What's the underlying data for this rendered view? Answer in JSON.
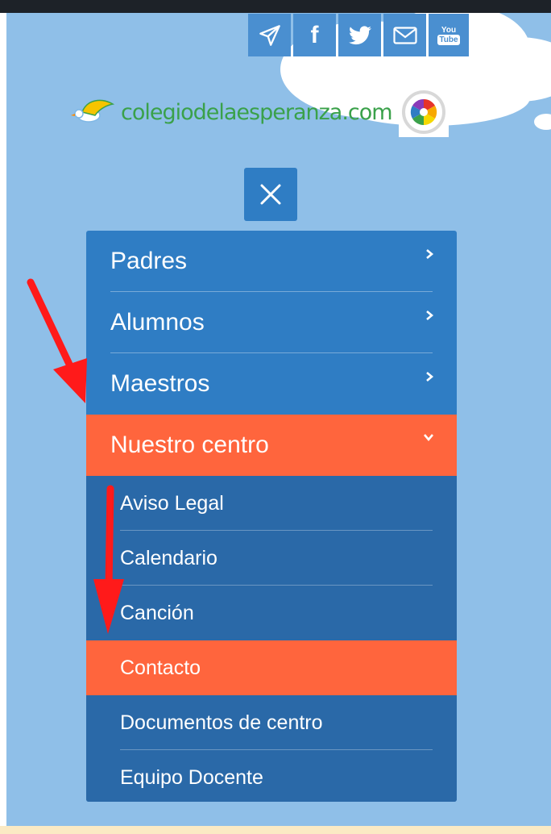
{
  "brand": {
    "site_name": "colegiodelaesperanza.com",
    "color": "#3aa14a",
    "badge_icon": "school-badge-icon"
  },
  "social": [
    {
      "name": "telegram",
      "icon": "paper-plane-icon"
    },
    {
      "name": "facebook",
      "icon": "facebook-icon",
      "glyph": "f"
    },
    {
      "name": "twitter",
      "icon": "twitter-icon"
    },
    {
      "name": "email",
      "icon": "envelope-icon"
    },
    {
      "name": "youtube",
      "icon": "youtube-icon",
      "glyph_top": "You",
      "glyph_bottom": "Tube"
    }
  ],
  "close_button": {
    "icon": "close-icon"
  },
  "menu": {
    "items": [
      {
        "label": "Padres",
        "icon": "chevron-right-icon",
        "expanded": false
      },
      {
        "label": "Alumnos",
        "icon": "chevron-right-icon",
        "expanded": false
      },
      {
        "label": "Maestros",
        "icon": "chevron-right-icon",
        "expanded": false
      },
      {
        "label": "Nuestro centro",
        "icon": "chevron-down-icon",
        "expanded": true,
        "active": true
      }
    ],
    "submenu": [
      {
        "label": "Aviso Legal"
      },
      {
        "label": "Calendario"
      },
      {
        "label": "Canción"
      },
      {
        "label": "Contacto",
        "active": true
      },
      {
        "label": "Documentos de centro"
      },
      {
        "label": "Equipo Docente"
      }
    ]
  },
  "colors": {
    "sky": "#8fbfe8",
    "menu_blue": "#2f7dc4",
    "submenu_blue": "#2a69a8",
    "active_orange": "#ff653d",
    "annotation_red": "#ff1a1a"
  }
}
